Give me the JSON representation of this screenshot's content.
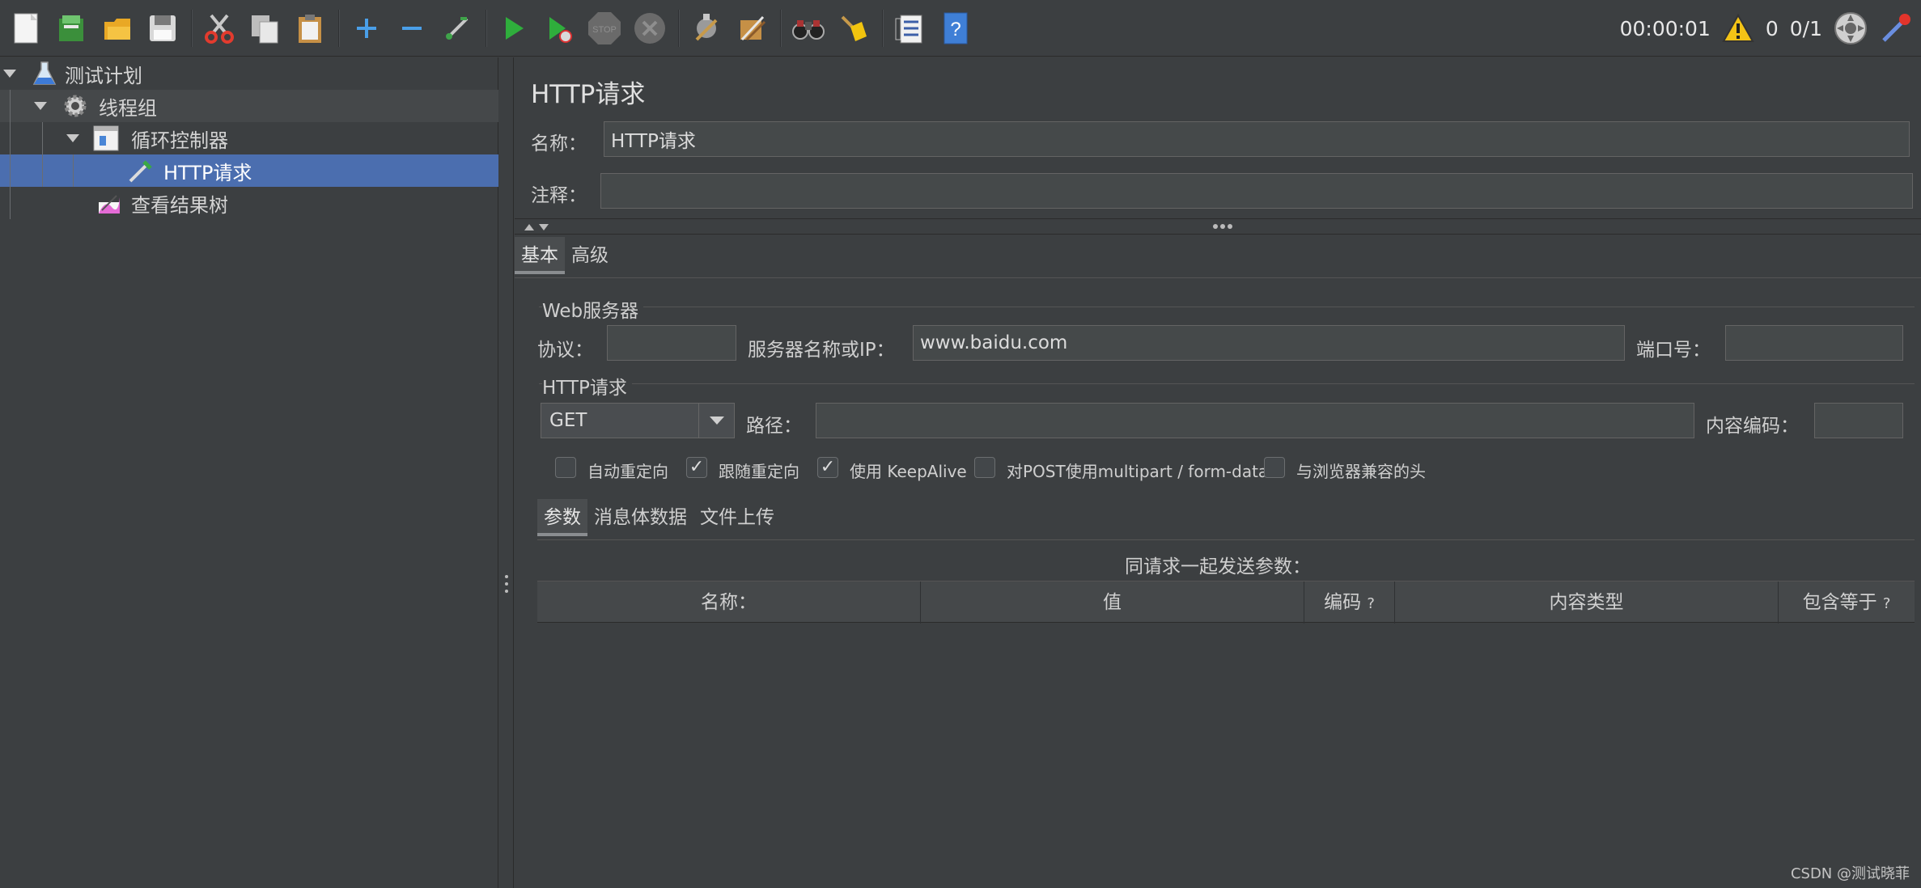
{
  "toolbar": {
    "buttons": [
      "new-icon",
      "templates-icon",
      "open-icon",
      "save-icon",
      "cut-icon",
      "copy-icon",
      "paste-icon",
      "expand-icon",
      "collapse-icon",
      "toggle-icon",
      "start-icon",
      "start-no-pauses-icon",
      "stop-icon",
      "shutdown-icon",
      "clear-icon",
      "clear-all-icon",
      "search-icon",
      "reset-search-icon",
      "function-helper-icon",
      "help-icon"
    ],
    "timer": "00:00:01",
    "warning_count": "0",
    "threads": "0/1"
  },
  "tree": {
    "items": [
      {
        "label": "测试计划",
        "icon": "test-plan-icon"
      },
      {
        "label": "线程组",
        "icon": "thread-group-icon"
      },
      {
        "label": "循环控制器",
        "icon": "loop-controller-icon"
      },
      {
        "label": "HTTP请求",
        "icon": "http-sampler-icon"
      },
      {
        "label": "查看结果树",
        "icon": "result-tree-icon"
      }
    ]
  },
  "panel": {
    "title": "HTTP请求",
    "name_label": "名称：",
    "name_value": "HTTP请求",
    "comment_label": "注释：",
    "comment_value": "",
    "tabs": [
      "基本",
      "高级"
    ],
    "web_server": {
      "group_title": "Web服务器",
      "protocol_label": "协议：",
      "protocol_value": "",
      "server_label": "服务器名称或IP：",
      "server_value": "www.baidu.com",
      "port_label": "端口号：",
      "port_value": ""
    },
    "http_request": {
      "group_title": "HTTP请求",
      "method": "GET",
      "path_label": "路径：",
      "path_value": "",
      "encoding_label": "内容编码：",
      "encoding_value": ""
    },
    "checkboxes": [
      {
        "label": "自动重定向",
        "checked": false
      },
      {
        "label": "跟随重定向",
        "checked": true
      },
      {
        "label": "使用 KeepAlive",
        "checked": true
      },
      {
        "label": "对POST使用multipart / form-data",
        "checked": false
      },
      {
        "label": "与浏览器兼容的头",
        "checked": false
      }
    ],
    "sub_tabs": [
      "参数",
      "消息体数据",
      "文件上传"
    ],
    "params_caption": "同请求一起发送参数：",
    "columns": [
      "名称：",
      "值",
      "编码",
      "内容类型",
      "包含等于"
    ],
    "column_hint": "?"
  },
  "watermark": "CSDN @测试晓菲"
}
